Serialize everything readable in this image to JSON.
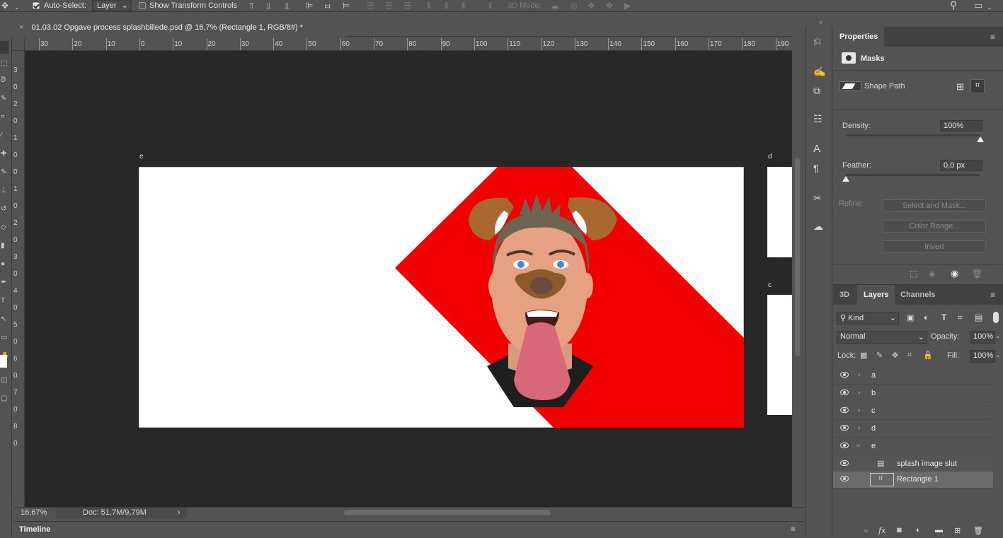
{
  "options_bar": {
    "auto_select_label": "Auto-Select:",
    "auto_select_value": "Layer",
    "show_transform_label": "Show Transform Controls",
    "mode_3d_label": "3D Mode:"
  },
  "document": {
    "tab_title": "01.03.02 Opgave process splashbillede.psd @ 16,7% (Rectangle 1, RGB/8#) *",
    "close_glyph": "×"
  },
  "ruler": {
    "h_labels": [
      "30",
      "20",
      "10",
      "0",
      "10",
      "20",
      "30",
      "40",
      "50",
      "60",
      "70",
      "80",
      "90",
      "100",
      "110",
      "120",
      "130",
      "140",
      "150",
      "160",
      "170",
      "180",
      "190"
    ],
    "v_labels": [
      "3",
      "0",
      "2",
      "0",
      "1",
      "0",
      "0",
      "1",
      "0",
      "2",
      "0",
      "3",
      "0",
      "4",
      "0",
      "5",
      "0",
      "6",
      "0",
      "7",
      "0",
      "8",
      "0"
    ]
  },
  "artboards": {
    "e": "e",
    "d": "d",
    "c": "c"
  },
  "colors": {
    "accent_red": "#f20000",
    "canvas_bg": "#282828",
    "panel_bg": "#535353"
  },
  "status": {
    "zoom": "16,67%",
    "doc_info": "Doc: 51,7M/9,79M",
    "arrow": "›"
  },
  "timeline": {
    "label": "Timeline"
  },
  "properties": {
    "tab": "Properties",
    "section": "Masks",
    "shape_path": "Shape Path",
    "density_label": "Density:",
    "density_value": "100%",
    "density_level": 1.0,
    "feather_label": "Feather:",
    "feather_value": "0,0 px",
    "feather_level": 0.0,
    "refine_label": "Refine:",
    "select_mask_btn": "Select and Mask...",
    "color_range_btn": "Color Range...",
    "invert_btn": "Invert"
  },
  "layers_panel": {
    "tabs": [
      "3D",
      "Layers",
      "Channels"
    ],
    "active_tab": "Layers",
    "filter_kind": "Kind",
    "blend_mode": "Normal",
    "opacity_label": "Opacity:",
    "opacity_value": "100%",
    "lock_label": "Lock:",
    "fill_label": "Fill:",
    "fill_value": "100%",
    "layers": [
      {
        "name": "a",
        "type": "group",
        "expanded": false
      },
      {
        "name": "b",
        "type": "group",
        "expanded": false
      },
      {
        "name": "c",
        "type": "group",
        "expanded": false
      },
      {
        "name": "d",
        "type": "group",
        "expanded": false
      },
      {
        "name": "e",
        "type": "group",
        "expanded": true
      },
      {
        "name": "splash image slut",
        "type": "smart-object",
        "expanded": false
      },
      {
        "name": "Rectangle 1",
        "type": "shape",
        "selected": true
      }
    ],
    "footer_icons": [
      "link-icon",
      "fx-icon",
      "mask-icon",
      "adjustment-icon",
      "folder-icon",
      "new-layer-icon",
      "trash-icon"
    ]
  }
}
